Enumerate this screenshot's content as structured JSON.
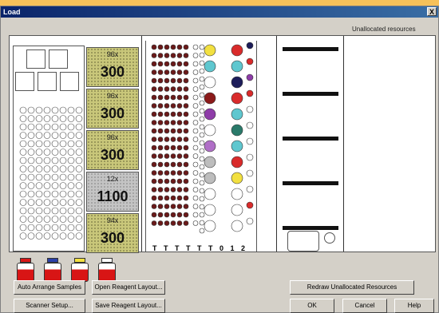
{
  "window": {
    "title": "Load",
    "close_label": "X"
  },
  "panels": {
    "unallocated_label": "Unallocated resources"
  },
  "troughs": [
    {
      "multiplier": "96x",
      "volume": "300",
      "style": "green"
    },
    {
      "multiplier": "96x",
      "volume": "300",
      "style": "green"
    },
    {
      "multiplier": "96x",
      "volume": "300",
      "style": "green"
    },
    {
      "multiplier": "12x",
      "volume": "1100",
      "style": "gray"
    },
    {
      "multiplier": "94x",
      "volume": "300",
      "style": "green"
    }
  ],
  "tube_rack": {
    "labels": "T T T T T T   0     1  2"
  },
  "bottles": [
    {
      "cap_color": "#d81515"
    },
    {
      "cap_color": "#2a3fa8"
    },
    {
      "cap_color": "#f2e040"
    },
    {
      "cap_color": "#ffffff"
    }
  ],
  "buttons": {
    "auto_arrange": "Auto Arrange Samples",
    "open_reagent": "Open Reagent Layout...",
    "redraw": "Redraw Unallocated Resources",
    "scanner_setup": "Scanner Setup...",
    "save_reagent": "Save Reagent Layout...",
    "ok": "OK",
    "cancel": "Cancel",
    "help": "Help"
  }
}
